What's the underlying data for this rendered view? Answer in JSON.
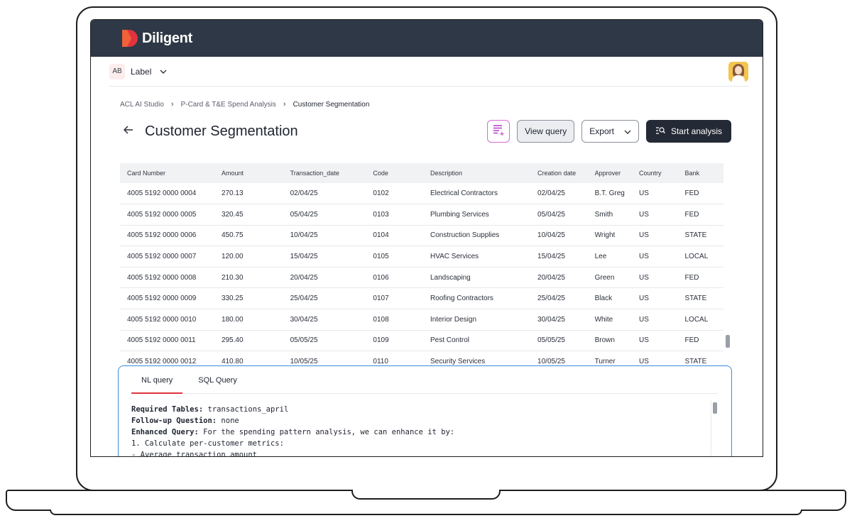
{
  "app": {
    "brand": "Diligent"
  },
  "subbar": {
    "org_initials": "AB",
    "org_label": "Label"
  },
  "breadcrumb": [
    "ACL AI Studio",
    "P-Card & T&E Spend Analysis",
    "Customer Segmentation"
  ],
  "page": {
    "title": "Customer Segmentation"
  },
  "actions": {
    "view_query": "View query",
    "export": "Export",
    "start_analysis": "Start analysis"
  },
  "table": {
    "columns": [
      "Card Number",
      "Amount",
      "Transaction_date",
      "Code",
      "Description",
      "Creation date",
      "Approver",
      "Country",
      "Bank"
    ],
    "rows": [
      [
        "4005 5192 0000 0004",
        "270.13",
        "02/04/25",
        "0102",
        "Electrical Contractors",
        "02/04/25",
        "B.T. Greg",
        "US",
        "FED"
      ],
      [
        "4005 5192 0000 0005",
        "320.45",
        "05/04/25",
        "0103",
        "Plumbing Services",
        "05/04/25",
        "Smith",
        "US",
        "FED"
      ],
      [
        "4005 5192 0000 0006",
        "450.75",
        "10/04/25",
        "0104",
        "Construction Supplies",
        "10/04/25",
        "Wright",
        "US",
        "STATE"
      ],
      [
        "4005 5192 0000 0007",
        "120.00",
        "15/04/25",
        "0105",
        "HVAC Services",
        "15/04/25",
        "Lee",
        "US",
        "LOCAL"
      ],
      [
        "4005 5192 0000 0008",
        "210.30",
        "20/04/25",
        "0106",
        "Landscaping",
        "20/04/25",
        "Green",
        "US",
        "FED"
      ],
      [
        "4005 5192 0000 0009",
        "330.25",
        "25/04/25",
        "0107",
        "Roofing Contractors",
        "25/04/25",
        "Black",
        "US",
        "STATE"
      ],
      [
        "4005 5192 0000 0010",
        "180.00",
        "30/04/25",
        "0108",
        "Interior Design",
        "30/04/25",
        "White",
        "US",
        "LOCAL"
      ],
      [
        "4005 5192 0000 0011",
        "295.40",
        "05/05/25",
        "0109",
        "Pest Control",
        "05/05/25",
        "Brown",
        "US",
        "FED"
      ],
      [
        "4005 5192 0000 0012",
        "410.80",
        "10/05/25",
        "0110",
        "Security Services",
        "10/05/25",
        "Turner",
        "US",
        "STATE"
      ]
    ]
  },
  "query_panel": {
    "tabs": [
      "NL query",
      "SQL Query"
    ],
    "active_tab": "NL query",
    "lines": [
      {
        "label": "Required Tables:",
        "text": " transactions_april"
      },
      {
        "label": "Follow-up Question:",
        "text": " none"
      },
      {
        "label": "Enhanced Query:",
        "text": " For the spending pattern analysis, we can enhance it by:"
      },
      {
        "label": "",
        "text": "1. Calculate per-customer metrics:"
      },
      {
        "label": "",
        "text": "- Average transaction amount"
      }
    ]
  },
  "colors": {
    "topbar": "#2e3846",
    "brand_red": "#e0343d",
    "primary_button": "#232a35",
    "panel_border": "#3b8ae0",
    "ai_icon": "#d86ad6"
  },
  "icons": [
    "diligent-logo-icon",
    "chevron-down-icon",
    "avatar",
    "back-arrow-icon",
    "ai-report-icon",
    "search-analysis-icon"
  ]
}
